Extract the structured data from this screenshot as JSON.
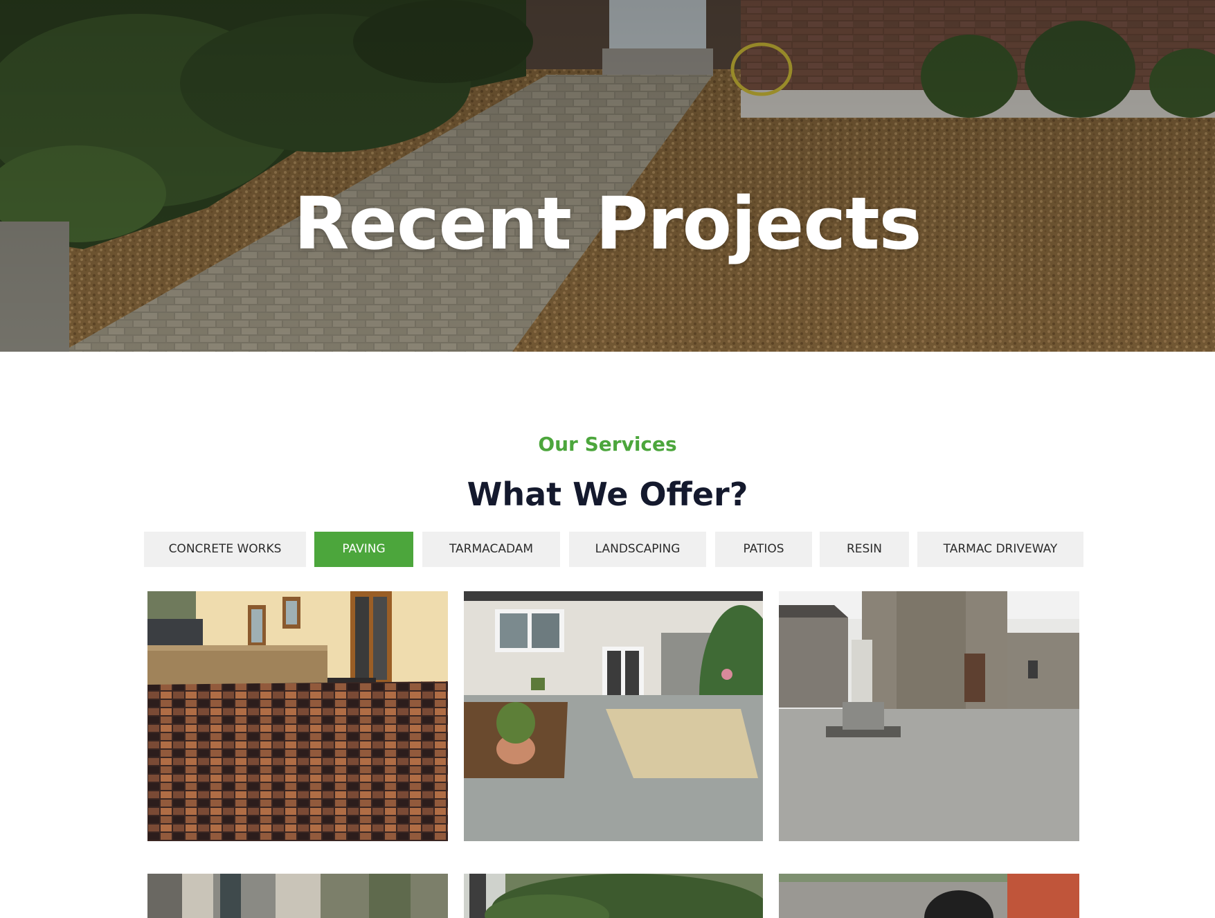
{
  "hero": {
    "title": "Recent Projects",
    "background_image": "gravel-driveway-with-paved-path"
  },
  "services": {
    "eyebrow": "Our Services",
    "title": "What We Offer?"
  },
  "filters": {
    "active_index": 1,
    "active_color": "#4ca63c",
    "items": [
      {
        "label": "CONCRETE WORKS"
      },
      {
        "label": "PAVING"
      },
      {
        "label": "TARMACADAM"
      },
      {
        "label": "LANDSCAPING"
      },
      {
        "label": "PATIOS"
      },
      {
        "label": "RESIN"
      },
      {
        "label": "TARMAC DRIVEWAY"
      }
    ]
  },
  "gallery": {
    "items": [
      {
        "image": "multicolour-brick-paved-patio"
      },
      {
        "image": "garden-patio-with-decking-and-gravel"
      },
      {
        "image": "paved-church-plaza-with-statue"
      },
      {
        "image": "house-front-paving"
      },
      {
        "image": "garden-hedge-paving"
      },
      {
        "image": "yard-with-oil-tank"
      }
    ]
  },
  "colors": {
    "accent": "#4ca63c",
    "heading": "#14192d",
    "tab_background": "#f0f0f0"
  }
}
